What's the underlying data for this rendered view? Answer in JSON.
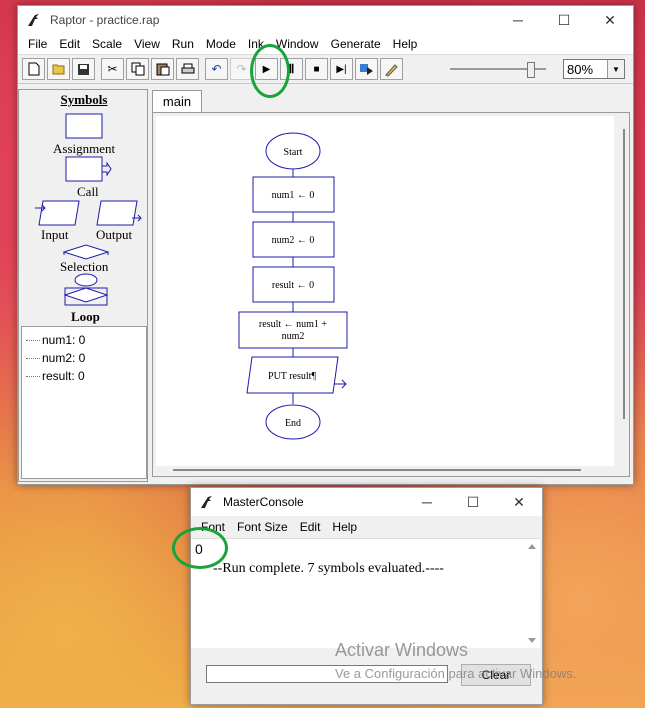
{
  "main_window": {
    "title": "Raptor - practice.rap",
    "menu": [
      "File",
      "Edit",
      "Scale",
      "View",
      "Run",
      "Mode",
      "Ink",
      "Window",
      "Generate",
      "Help"
    ],
    "toolbar_icons": [
      "new-file-icon",
      "open-folder-icon",
      "save-icon",
      "cut-icon",
      "copy-icon",
      "paste-icon",
      "print-icon",
      "undo-icon",
      "redo-icon",
      "play-icon",
      "pause-icon",
      "stop-icon",
      "step-icon",
      "step-into-icon",
      "pen-icon"
    ],
    "zoom_value": "80%",
    "speed_slider_level": 0.85
  },
  "symbols": {
    "title": "Symbols",
    "items": [
      "Assignment",
      "Call",
      "Input",
      "Output",
      "Selection",
      "Loop"
    ]
  },
  "variables": [
    "num1: 0",
    "num2: 0",
    "result: 0"
  ],
  "tabs": [
    "main"
  ],
  "flowchart": {
    "start": "Start",
    "steps": [
      "num1 ← 0",
      "num2 ← 0",
      "result ← 0"
    ],
    "sum_line1": "result ← num1 +",
    "sum_line2": "num2",
    "output": "PUT result¶",
    "end": "End"
  },
  "console": {
    "title": "MasterConsole",
    "menu": [
      "Font",
      "Font Size",
      "Edit",
      "Help"
    ],
    "output_value": "0",
    "status": "--Run complete.  7 symbols evaluated.----",
    "clear_label": "Clear"
  },
  "watermark": {
    "line1": "Activar Windows",
    "line2": "Ve a Configuración para activar Windows."
  },
  "colors": {
    "flow_stroke": "#1c1caa",
    "highlight_circle": "#1aa33a"
  }
}
